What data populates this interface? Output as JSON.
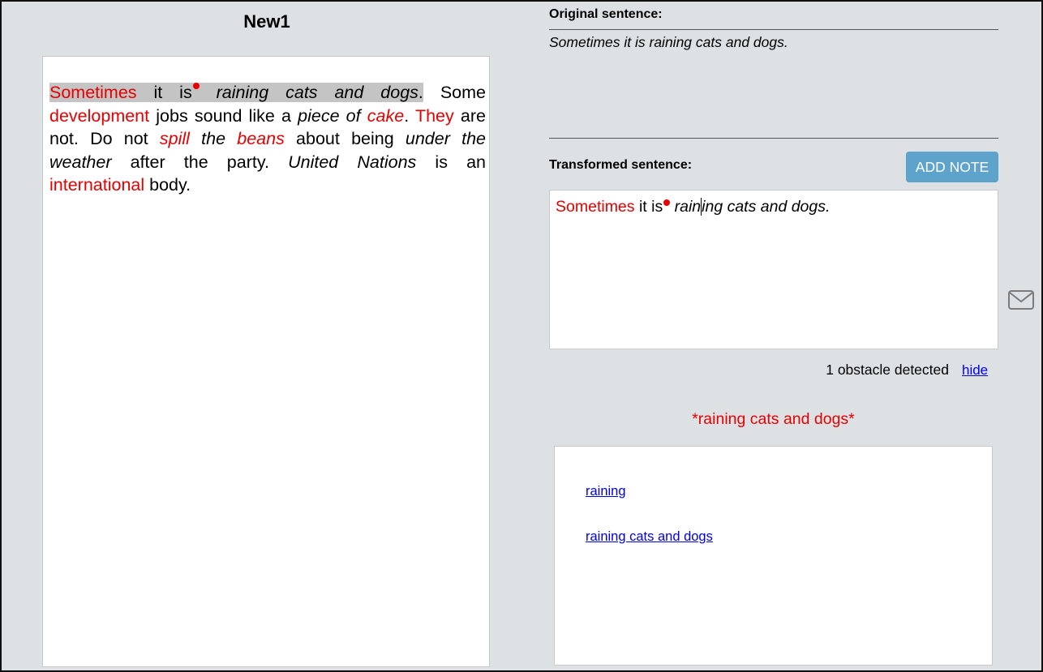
{
  "document": {
    "title": "New1",
    "text": [
      {
        "t": "Sometimes",
        "red": true,
        "hl": true
      },
      {
        "t": " it is",
        "hl": true
      },
      {
        "dot": true,
        "hl": true
      },
      {
        "t": " raining cats and dogs",
        "it": true,
        "hl": true
      },
      {
        "t": ".",
        "hl": true
      },
      {
        "t": " Some "
      },
      {
        "t": "development",
        "red": true
      },
      {
        "t": " jobs sound like a "
      },
      {
        "t": "piece of",
        "it": true
      },
      {
        "t": " "
      },
      {
        "t": "cake",
        "red": true,
        "it": true
      },
      {
        "t": ". "
      },
      {
        "t": "They",
        "red": true
      },
      {
        "t": " are not. Do not "
      },
      {
        "t": "spill",
        "red": true,
        "it": true
      },
      {
        "t": " "
      },
      {
        "t": "the",
        "it": true
      },
      {
        "t": " "
      },
      {
        "t": "beans",
        "red": true,
        "it": true
      },
      {
        "t": " about being "
      },
      {
        "t": "under the weather",
        "it": true
      },
      {
        "t": " after the party. "
      },
      {
        "t": "United Nations",
        "it": true
      },
      {
        "t": " is an "
      },
      {
        "t": "international",
        "red": true
      },
      {
        "t": " body."
      }
    ]
  },
  "original": {
    "label": "Original sentence:",
    "sentence": "Sometimes it is raining cats and dogs."
  },
  "transformed": {
    "label": "Transformed sentence:",
    "add_note_label": "ADD NOTE",
    "part_red": "Sometimes",
    "part_plain": " it is",
    "part_italic_a": " rain",
    "part_italic_b": "ing cats and dogs."
  },
  "obstacles": {
    "count_text": "1 obstacle detected",
    "hide_label": "hide",
    "phrase": "*raining cats and dogs*",
    "suggestions": [
      "raining",
      "raining cats and dogs"
    ]
  },
  "colors": {
    "accent_red": "#e60000",
    "button_blue": "#5ea3cc",
    "link_blue": "#0000ee",
    "background": "#dde1e4"
  },
  "icons": {
    "mail": "envelope-icon"
  }
}
